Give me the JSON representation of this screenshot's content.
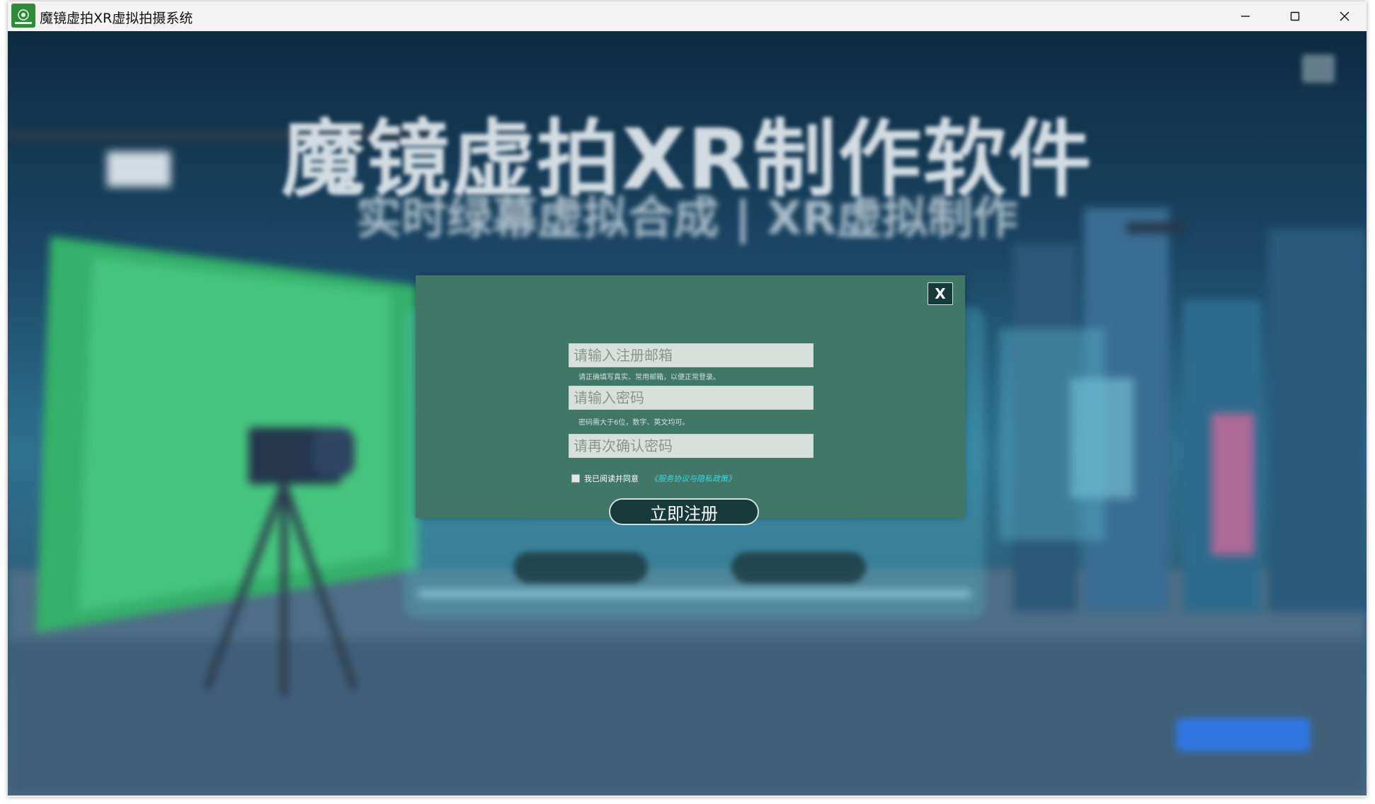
{
  "window": {
    "title": "魔镜虚拍XR虚拟拍摄系统",
    "icon": "app-logo-icon"
  },
  "background": {
    "hero_title": "魔镜虚拍XR制作软件",
    "hero_subtitle": "实时绿幕虚拟合成 | XR虚拟制作"
  },
  "register_modal": {
    "close_label": "X",
    "email": {
      "value": "",
      "placeholder": "请输入注册邮箱",
      "hint": "请正确填写真实、常用邮箱，以便正常登录。"
    },
    "password": {
      "value": "",
      "placeholder": "请输入密码",
      "hint": "密码需大于6位，数字、英文均可。"
    },
    "confirm_password": {
      "value": "",
      "placeholder": "请再次确认密码"
    },
    "agree_label": "我已阅读并同意",
    "agree_checked": false,
    "policy_link": "《服务协议与隐私政策》",
    "submit_label": "立即注册"
  },
  "colors": {
    "modal_bg": "#417767",
    "button_bg": "#163a3a",
    "link": "#39d9e8"
  }
}
